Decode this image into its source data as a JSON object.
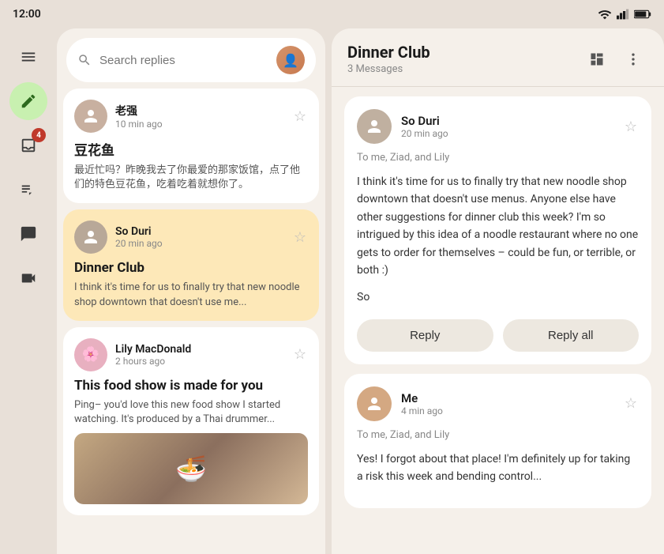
{
  "statusBar": {
    "time": "12:00"
  },
  "sidebar": {
    "items": [
      {
        "id": "menu",
        "icon": "menu",
        "active": false,
        "badge": null
      },
      {
        "id": "compose",
        "icon": "edit",
        "active": true,
        "badge": null
      },
      {
        "id": "inbox",
        "icon": "inbox",
        "active": false,
        "badge": "4"
      },
      {
        "id": "notes",
        "icon": "notes",
        "active": false,
        "badge": null
      },
      {
        "id": "chat",
        "icon": "chat",
        "active": false,
        "badge": null
      },
      {
        "id": "video",
        "icon": "video",
        "active": false,
        "badge": null
      }
    ]
  },
  "search": {
    "placeholder": "Search replies"
  },
  "messages": [
    {
      "id": "msg1",
      "sender": "老强",
      "time": "10 min ago",
      "title": "豆花鱼",
      "preview": "最近忙吗？昨晚我去了你最爱的那家饭馆，点了他们的特色豆花鱼，吃着吃着就想你了。",
      "selected": false,
      "avatarColor": "#b8a898",
      "avatarEmoji": "👤"
    },
    {
      "id": "msg2",
      "sender": "So Duri",
      "time": "20 min ago",
      "title": "Dinner Club",
      "preview": "I think it's time for us to finally try that new noodle shop downtown that doesn't use me...",
      "selected": true,
      "avatarColor": "#c8b8a8",
      "avatarEmoji": "👤"
    },
    {
      "id": "msg3",
      "sender": "Lily MacDonald",
      "time": "2 hours ago",
      "title": "This food show is made for you",
      "preview": "Ping– you'd love this new food show I started watching. It's produced by a Thai drummer...",
      "selected": false,
      "avatarColor": "#e8a8b8",
      "avatarEmoji": "🌸"
    }
  ],
  "detail": {
    "title": "Dinner Club",
    "subtitle": "3 Messages",
    "emails": [
      {
        "id": "email1",
        "sender": "So Duri",
        "time": "20 min ago",
        "to": "To me, Ziad, and Lily",
        "body": [
          "I think it's time for us to finally try that new noodle shop downtown that doesn't use menus. Anyone else have other suggestions for dinner club this week? I'm so intrigued by this idea of a noodle restaurant where no one gets to order for themselves – could be fun, or terrible, or both :)",
          "So"
        ],
        "avatarColor": "#c8b8a8",
        "showReply": true
      },
      {
        "id": "email2",
        "sender": "Me",
        "time": "4 min ago",
        "to": "To me, Ziad, and Lily",
        "body": [
          "Yes! I forgot about that place! I'm definitely up for taking a risk this week and bending control..."
        ],
        "avatarColor": "#d4a882",
        "showReply": false
      }
    ],
    "replyBtn": "Reply",
    "replyAllBtn": "Reply all"
  }
}
